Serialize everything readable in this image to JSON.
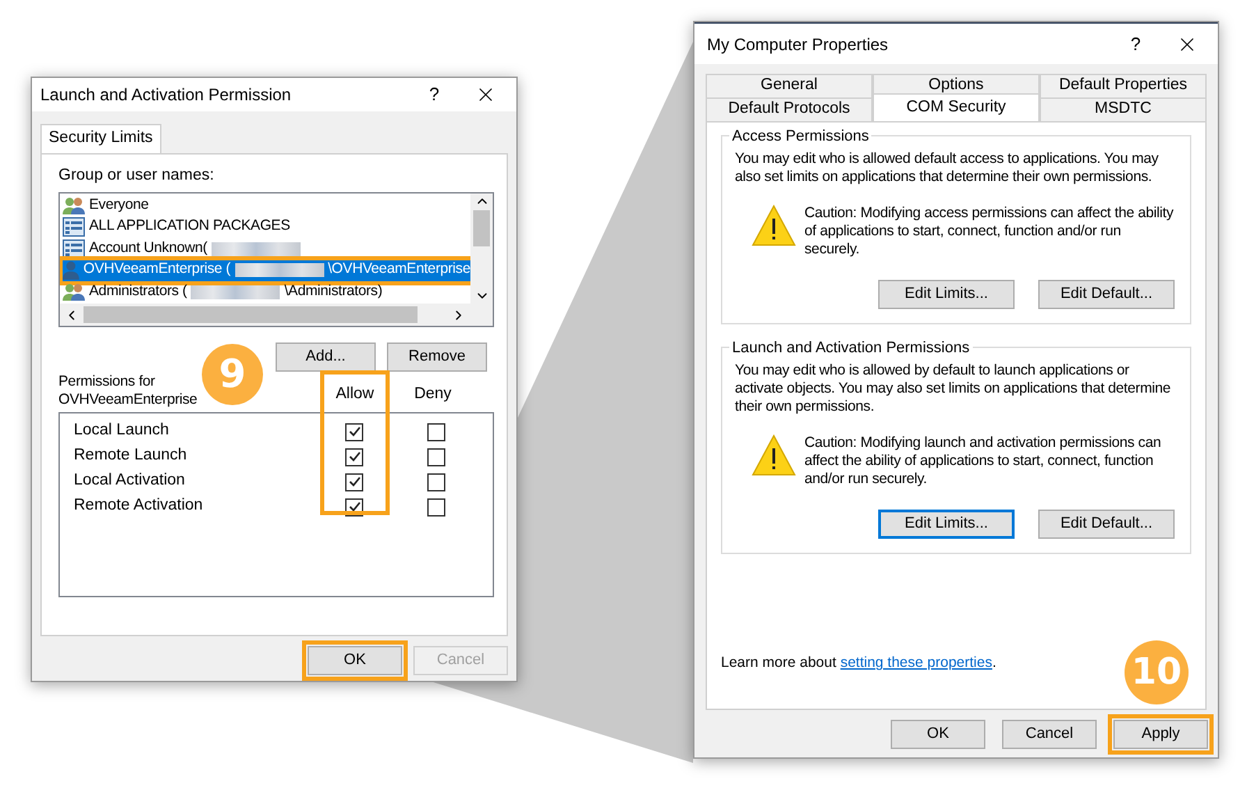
{
  "left_dialog": {
    "title": "Launch and Activation Permission",
    "help": "?",
    "tabs": [
      {
        "label": "Security Limits",
        "selected": true
      }
    ],
    "group_label": "Group or user names:",
    "users": [
      {
        "kind": "group",
        "name": "Everyone",
        "selected": false,
        "highlighted": false
      },
      {
        "kind": "package",
        "name": "ALL APPLICATION PACKAGES",
        "selected": false,
        "highlighted": false
      },
      {
        "kind": "unknown",
        "name": "Account Unknown(",
        "redacted": true,
        "selected": false,
        "highlighted": false
      },
      {
        "kind": "user",
        "name": "OVHVeeamEnterprise (",
        "redacted": true,
        "suffix": "\\OVHVeeamEnterprise",
        "selected": true,
        "highlighted": true
      },
      {
        "kind": "group",
        "name": "Administrators (",
        "redacted": true,
        "suffix": "\\Administrators)",
        "selected": false,
        "highlighted": false
      }
    ],
    "list_buttons": [
      {
        "label": "Add..."
      },
      {
        "label": "Remove"
      }
    ],
    "permissions_label": "Permissions for OVHVeeamEnterprise",
    "columns": [
      {
        "label": "Allow",
        "highlighted": true
      },
      {
        "label": "Deny",
        "highlighted": false
      }
    ],
    "permissions": [
      {
        "name": "Local Launch",
        "allow": true,
        "deny": false
      },
      {
        "name": "Remote Launch",
        "allow": true,
        "deny": false
      },
      {
        "name": "Local Activation",
        "allow": true,
        "deny": false
      },
      {
        "name": "Remote Activation",
        "allow": true,
        "deny": false
      }
    ],
    "footer_buttons": [
      {
        "label": "OK",
        "disabled": false,
        "highlighted": true
      },
      {
        "label": "Cancel",
        "disabled": true,
        "highlighted": false
      }
    ],
    "step": "9"
  },
  "right_dialog": {
    "title": "My Computer Properties",
    "help": "?",
    "tab_rows": [
      [
        {
          "label": "General",
          "selected": false
        },
        {
          "label": "Options",
          "selected": false
        },
        {
          "label": "Default Properties",
          "selected": false
        }
      ],
      [
        {
          "label": "Default Protocols",
          "selected": false
        },
        {
          "label": "COM Security",
          "selected": true
        },
        {
          "label": "MSDTC",
          "selected": false
        }
      ]
    ],
    "groups": [
      {
        "title": "Access Permissions",
        "description": "You may edit who is allowed default access to applications. You may also set limits on applications that determine their own permissions.",
        "caution": "Caution: Modifying access permissions can affect the ability of applications to start, connect, function and/or run securely.",
        "buttons": [
          {
            "label": "Edit Limits...",
            "focused": false
          },
          {
            "label": "Edit Default...",
            "focused": false
          }
        ]
      },
      {
        "title": "Launch and Activation Permissions",
        "description": "You may edit who is allowed by default to launch applications or activate objects. You may also set limits on applications that determine their own permissions.",
        "caution": "Caution: Modifying launch and activation permissions can affect the ability of applications to start, connect, function and/or run securely.",
        "buttons": [
          {
            "label": "Edit Limits...",
            "focused": true
          },
          {
            "label": "Edit Default...",
            "focused": false
          }
        ]
      }
    ],
    "learn_more": {
      "text": "Learn more about",
      "link": "setting these properties",
      "end": "."
    },
    "footer_buttons": [
      {
        "label": "OK",
        "disabled": false,
        "highlighted": false
      },
      {
        "label": "Cancel",
        "disabled": false,
        "highlighted": false
      },
      {
        "label": "Apply",
        "disabled": false,
        "highlighted": true
      }
    ],
    "step": "10"
  }
}
